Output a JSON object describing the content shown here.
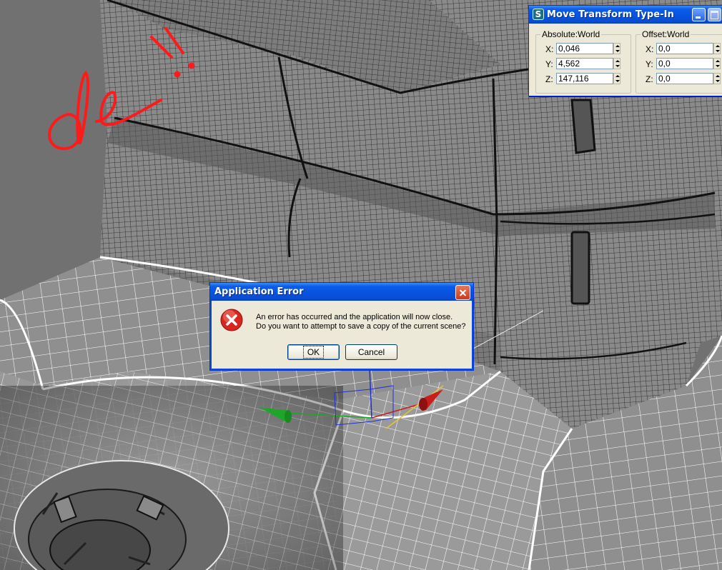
{
  "transform_window": {
    "title": "Move Transform Type-In",
    "app_icon": "S",
    "absolute": {
      "label": "Absolute:World",
      "x_label": "X:",
      "x_value": "0,046",
      "y_label": "Y:",
      "y_value": "4,562",
      "z_label": "Z:",
      "z_value": "147,116"
    },
    "offset": {
      "label": "Offset:World",
      "x_label": "X:",
      "x_value": "0,0",
      "y_label": "Y:",
      "y_value": "0,0",
      "z_label": "Z:",
      "z_value": "0,0"
    }
  },
  "error_dialog": {
    "title": "Application Error",
    "message_line1": "An error has occurred and the application will now close.",
    "message_line2": "Do you want to attempt to save a copy of the current scene?",
    "ok_label": "OK",
    "cancel_label": "Cancel"
  },
  "colors": {
    "titlebar_blue": "#0a5cea",
    "dialog_face": "#ece9d8",
    "error_red": "#d7261e",
    "annotation_red": "#ff1a1a",
    "gizmo_green": "#1ea52a",
    "gizmo_red": "#c81e1e"
  },
  "icons": [
    "app-icon",
    "minimize-icon",
    "maximize-icon",
    "close-icon",
    "error-icon",
    "move-gizmo"
  ]
}
